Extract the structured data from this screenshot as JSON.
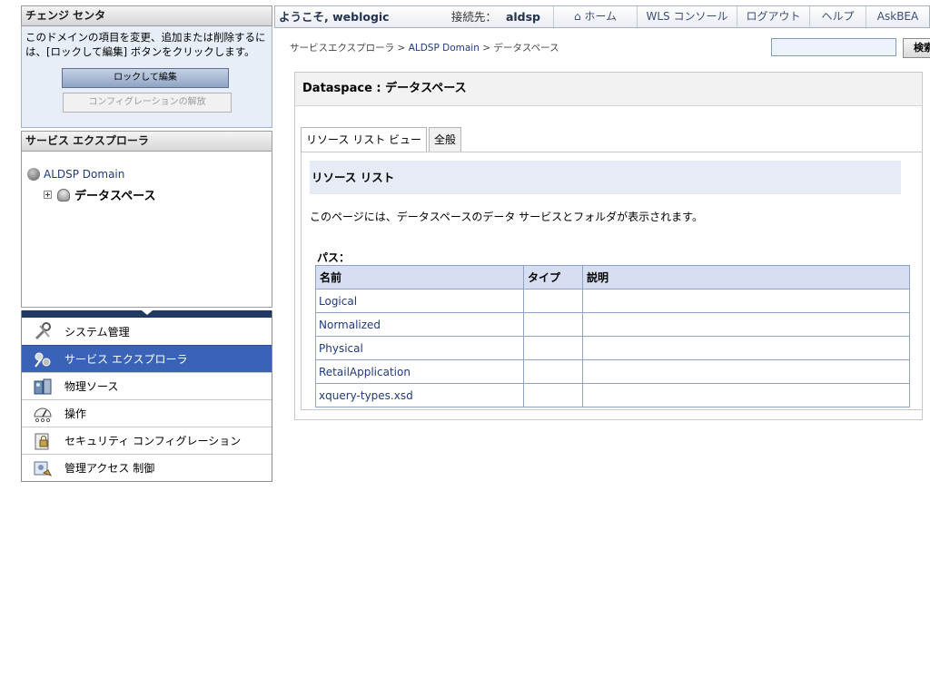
{
  "change_center": {
    "title": "チェンジ センタ",
    "description": "このドメインの項目を変更、追加または削除するには、[ロックして編集] ボタンをクリックします。",
    "lock_button": "ロックして編集",
    "release_button": "コンフィグレーションの解放"
  },
  "service_explorer": {
    "title": "サービス エクスプローラ",
    "root": "ALDSP Domain",
    "child": "データスペース"
  },
  "nav": {
    "items": [
      {
        "label": "システム管理",
        "icon": "admin-icon"
      },
      {
        "label": "サービス エクスプローラ",
        "icon": "service-explorer-icon"
      },
      {
        "label": "物理ソース",
        "icon": "physical-source-icon"
      },
      {
        "label": "操作",
        "icon": "operations-icon"
      },
      {
        "label": "セキュリティ コンフィグレーション",
        "icon": "security-icon"
      },
      {
        "label": "管理アクセス 制御",
        "icon": "access-control-icon"
      }
    ]
  },
  "header": {
    "welcome": "ようこそ, weblogic",
    "connected_label": "接続先：",
    "connected_value": "aldsp",
    "links": [
      "ホーム",
      "WLS コンソール",
      "ログアウト",
      "ヘルプ",
      "AskBEA"
    ]
  },
  "breadcrumb": {
    "part1": "サービスエクスプローラ",
    "part2": "ALDSP Domain",
    "part3": "データスペース",
    "sep": ">"
  },
  "search": {
    "placeholder": "",
    "button": "検索"
  },
  "content": {
    "title": "Dataspace : データスペース",
    "tabs": [
      "リソース リスト ビュー",
      "全般"
    ],
    "section_title": "リソース リスト",
    "description": "このページには、データスペースのデータ サービスとフォルダが表示されます。",
    "path_label": "パス：",
    "table": {
      "headers": [
        "名前",
        "タイプ",
        "説明"
      ],
      "rows": [
        {
          "name": "Logical",
          "type": "",
          "desc": ""
        },
        {
          "name": "Normalized",
          "type": "",
          "desc": ""
        },
        {
          "name": "Physical",
          "type": "",
          "desc": ""
        },
        {
          "name": "RetailApplication",
          "type": "",
          "desc": ""
        },
        {
          "name": "xquery-types.xsd",
          "type": "",
          "desc": ""
        }
      ]
    }
  },
  "colors": {
    "nav_active": "#3a62b6",
    "nav_bar": "#1f3a62",
    "link": "#213a7a"
  }
}
